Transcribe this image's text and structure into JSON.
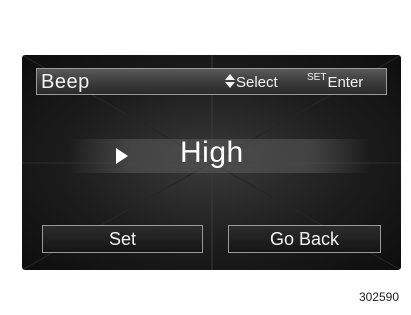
{
  "screen": {
    "title": "Beep",
    "hints": {
      "select_label": "Select",
      "enter_prefix": "SET",
      "enter_label": "Enter"
    },
    "current_value": "High",
    "buttons": {
      "set_label": "Set",
      "back_label": "Go Back"
    }
  },
  "figure_code": "302590",
  "icons": {
    "select_arrows": "up-down-arrows-icon",
    "pointer": "selection-pointer-icon"
  }
}
